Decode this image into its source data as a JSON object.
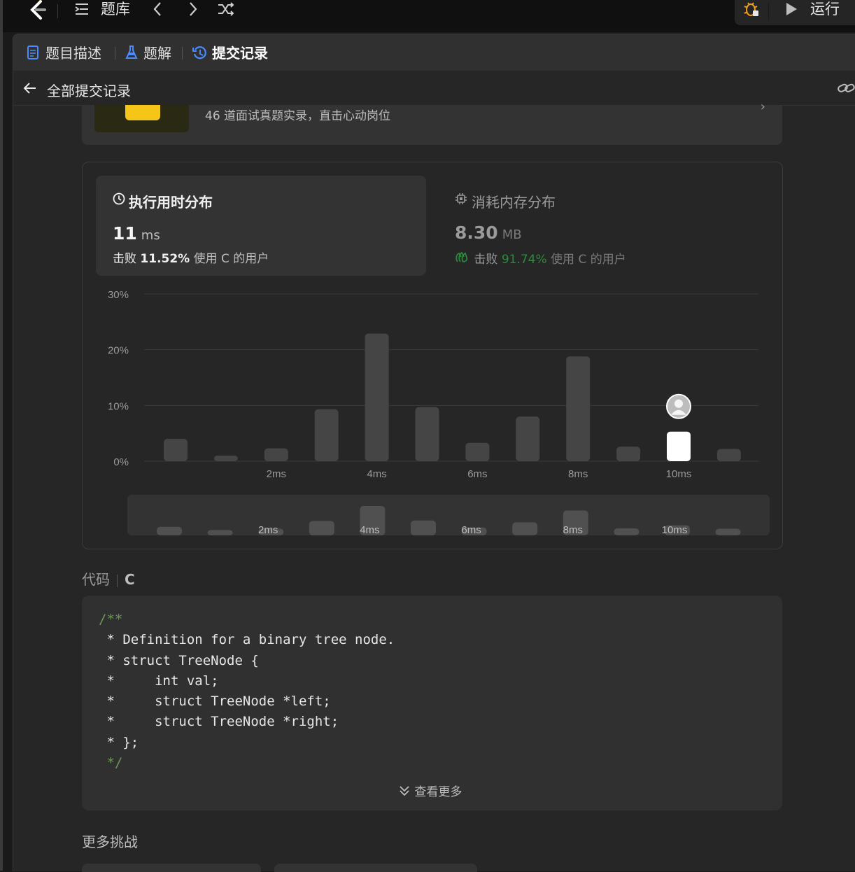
{
  "topnav": {
    "problemset_label": "题库",
    "run_label": "运行"
  },
  "tabs": [
    {
      "label": "题目描述"
    },
    {
      "label": "题解"
    },
    {
      "label": "提交记录"
    }
  ],
  "subheader": {
    "back_label": "全部提交记录"
  },
  "banner": {
    "text": "46 道面试真题实录，直击心动岗位"
  },
  "runtime": {
    "title": "执行用时分布",
    "value": "11",
    "unit": "ms",
    "beat_prefix": "击败",
    "beat_percent": "11.52%",
    "beat_suffix": "使用 C 的用户"
  },
  "memory": {
    "title": "消耗内存分布",
    "value": "8.30",
    "unit": "MB",
    "beat_prefix": "击败",
    "beat_percent": "91.74%",
    "beat_suffix": "使用 C 的用户"
  },
  "chart_data": {
    "type": "bar",
    "xlabel": "",
    "ylabel": "",
    "y_tick_labels": [
      "0%",
      "10%",
      "20%",
      "30%"
    ],
    "ylim": [
      0,
      30
    ],
    "x": [
      1,
      2,
      3,
      4,
      5,
      6,
      7,
      8,
      9,
      10,
      11,
      12
    ],
    "x_tick_labels": [
      "",
      "",
      "2ms",
      "",
      "4ms",
      "",
      "6ms",
      "",
      "8ms",
      "",
      "10ms",
      ""
    ],
    "values": [
      4.0,
      1.0,
      2.3,
      9.3,
      22.9,
      9.7,
      3.3,
      8.0,
      18.8,
      2.6,
      5.3,
      2.2
    ],
    "highlight_x": 11,
    "grid": true,
    "overview_labels": [
      "2ms",
      "4ms",
      "6ms",
      "8ms",
      "10ms"
    ],
    "colors": {
      "bar": "#454545",
      "highlight": "#ffffff",
      "grid": "#3a3a3a"
    }
  },
  "code": {
    "title": "代码",
    "language": "C",
    "lines": [
      {
        "text": "/**",
        "comment": true
      },
      {
        "text": " * Definition for a binary tree node.",
        "comment": false
      },
      {
        "text": " * struct TreeNode {",
        "comment": false
      },
      {
        "text": " *     int val;",
        "comment": false
      },
      {
        "text": " *     struct TreeNode *left;",
        "comment": false
      },
      {
        "text": " *     struct TreeNode *right;",
        "comment": false
      },
      {
        "text": " * };",
        "comment": false
      },
      {
        "text": " */",
        "comment": true
      }
    ],
    "show_more_label": "查看更多"
  },
  "more_challenges": {
    "title": "更多挑战"
  },
  "colors": {
    "accent_blue": "#4a8cff",
    "beat_green": "#2c8a3a",
    "comment_green": "#6a9955",
    "bug_orange": "#f0a020"
  }
}
